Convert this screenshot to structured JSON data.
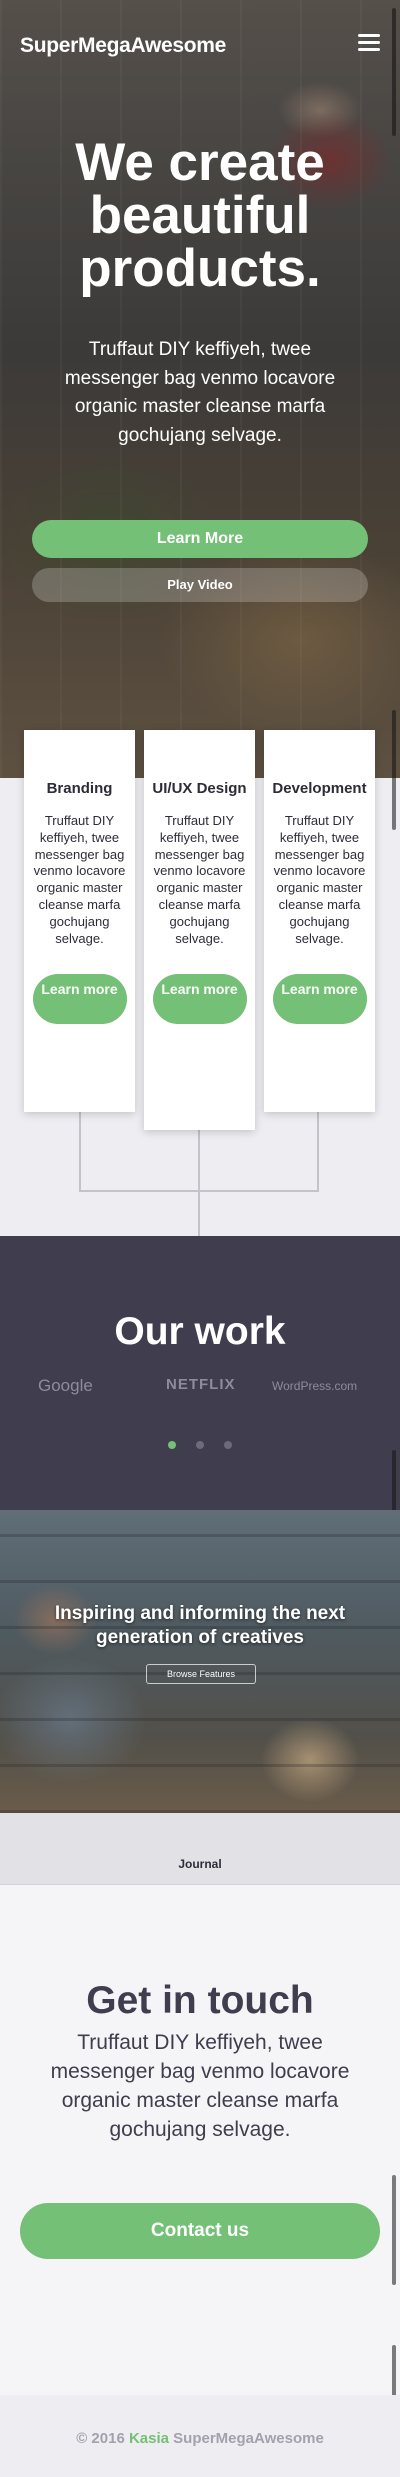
{
  "header": {
    "brand": "SuperMegaAwesome",
    "menu_icon": "hamburger-menu-icon"
  },
  "hero": {
    "title": "We create beautiful products.",
    "text": "Truffaut DIY keffiyeh, twee messenger bag venmo locavore organic master cleanse marfa gochujang selvage.",
    "primary_button": "Learn More",
    "secondary_button": "Play Video"
  },
  "services": [
    {
      "title": "Branding",
      "text": "Truffaut DIY keffiyeh, twee messenger bag venmo locavore organic master cleanse marfa gochujang selvage.",
      "button": "Learn more"
    },
    {
      "title": "UI/UX Design",
      "text": "Truffaut DIY keffiyeh, twee messenger bag venmo locavore organic master cleanse marfa gochujang selvage.",
      "button": "Learn more"
    },
    {
      "title": "Development",
      "text": "Truffaut DIY keffiyeh, twee messenger bag venmo locavore organic master cleanse marfa gochujang selvage.",
      "button": "Learn more"
    }
  ],
  "work": {
    "title": "Our work",
    "logos": [
      "Google",
      "NETFLIX",
      "WordPress.com"
    ],
    "carousel_dots": 3,
    "active_dot": 0
  },
  "inspire": {
    "text": "Inspiring and informing the next generation of creatives",
    "button": "Browse Features"
  },
  "journal": {
    "label": "Journal"
  },
  "contact": {
    "title": "Get in touch",
    "text": "Truffaut DIY keffiyeh, twee messenger bag venmo locavore organic master cleanse marfa gochujang selvage.",
    "button": "Contact us"
  },
  "footer": {
    "copyright": "© 2016",
    "author": "Kasia",
    "brand": "SuperMegaAwesome"
  },
  "colors": {
    "accent": "#74c076",
    "dark": "#403d4e",
    "muted": "#a3a1ad"
  }
}
